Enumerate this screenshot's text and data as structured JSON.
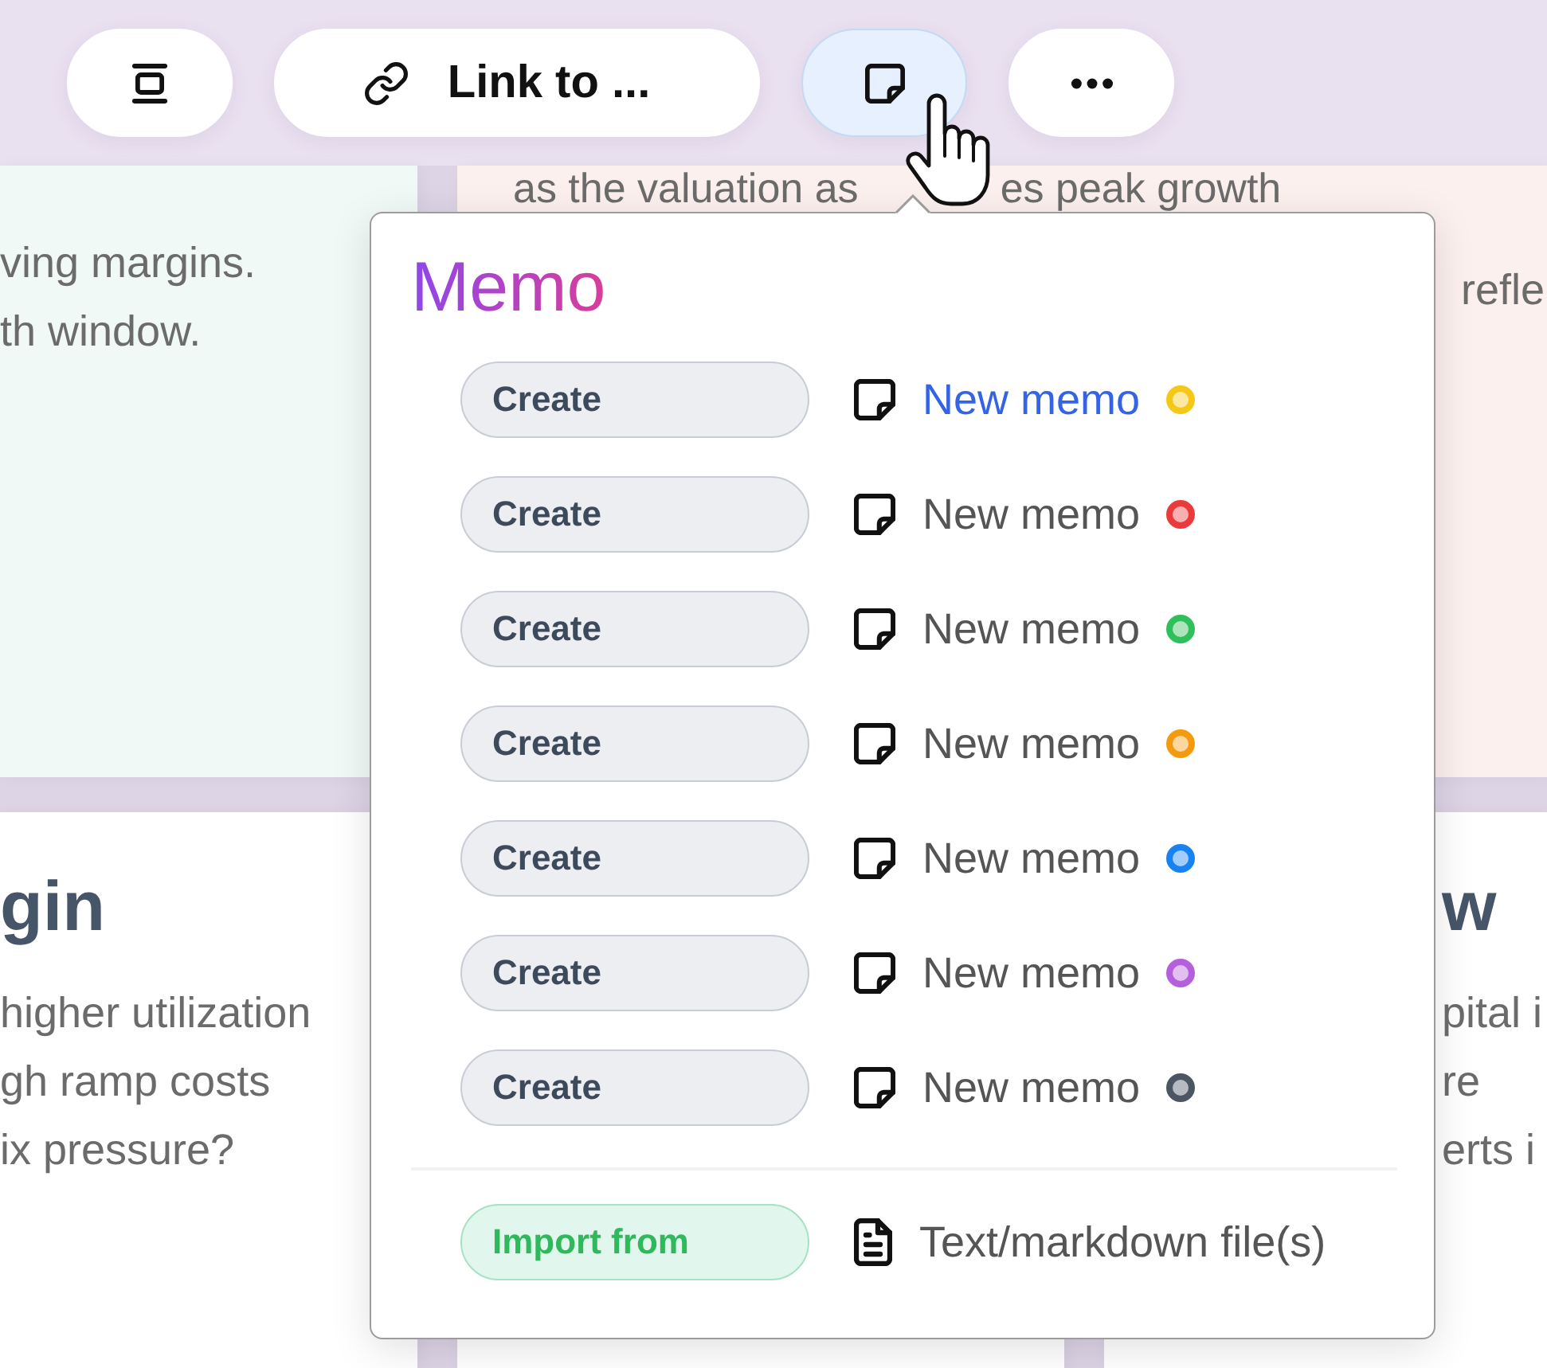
{
  "toolbar": {
    "buttons": [
      {
        "kind": "align",
        "selected": false
      },
      {
        "kind": "link",
        "label": "Link to ...",
        "selected": false
      },
      {
        "kind": "memo",
        "selected": true
      },
      {
        "kind": "more",
        "selected": false
      }
    ]
  },
  "board": {
    "cards": [
      {
        "color": "#f1f9f6",
        "lines": [
          "ving margins.",
          "th window."
        ]
      },
      {
        "color": "#fcf0ef",
        "fragments": [
          "as the valuation as",
          "es peak growth"
        ],
        "lines": [
          "refle"
        ]
      },
      {
        "color": "#ffffff",
        "title": "gin",
        "lines": [
          "higher utilization",
          "gh ramp costs",
          "ix pressure?"
        ]
      },
      {
        "color": "#ffffff"
      },
      {
        "color": "#ffffff",
        "title": "w",
        "lines": [
          "pital i",
          "re",
          "erts i"
        ]
      }
    ]
  },
  "menu": {
    "title": "Memo",
    "items": [
      {
        "kind": "create",
        "action": "Create",
        "label": "New memo",
        "color": "#f5c817",
        "selected": true
      },
      {
        "kind": "create",
        "action": "Create",
        "label": "New memo",
        "color": "#ea3a3a",
        "selected": false
      },
      {
        "kind": "create",
        "action": "Create",
        "label": "New memo",
        "color": "#2fbf5b",
        "selected": false
      },
      {
        "kind": "create",
        "action": "Create",
        "label": "New memo",
        "color": "#f39a0e",
        "selected": false
      },
      {
        "kind": "create",
        "action": "Create",
        "label": "New memo",
        "color": "#1783f2",
        "selected": false
      },
      {
        "kind": "create",
        "action": "Create",
        "label": "New memo",
        "color": "#b65fdc",
        "selected": false
      },
      {
        "kind": "create",
        "action": "Create",
        "label": "New memo",
        "color": "#4b5563",
        "selected": false
      },
      {
        "kind": "import",
        "action": "Import from",
        "label": "Text/markdown file(s)",
        "selected": false
      }
    ]
  }
}
